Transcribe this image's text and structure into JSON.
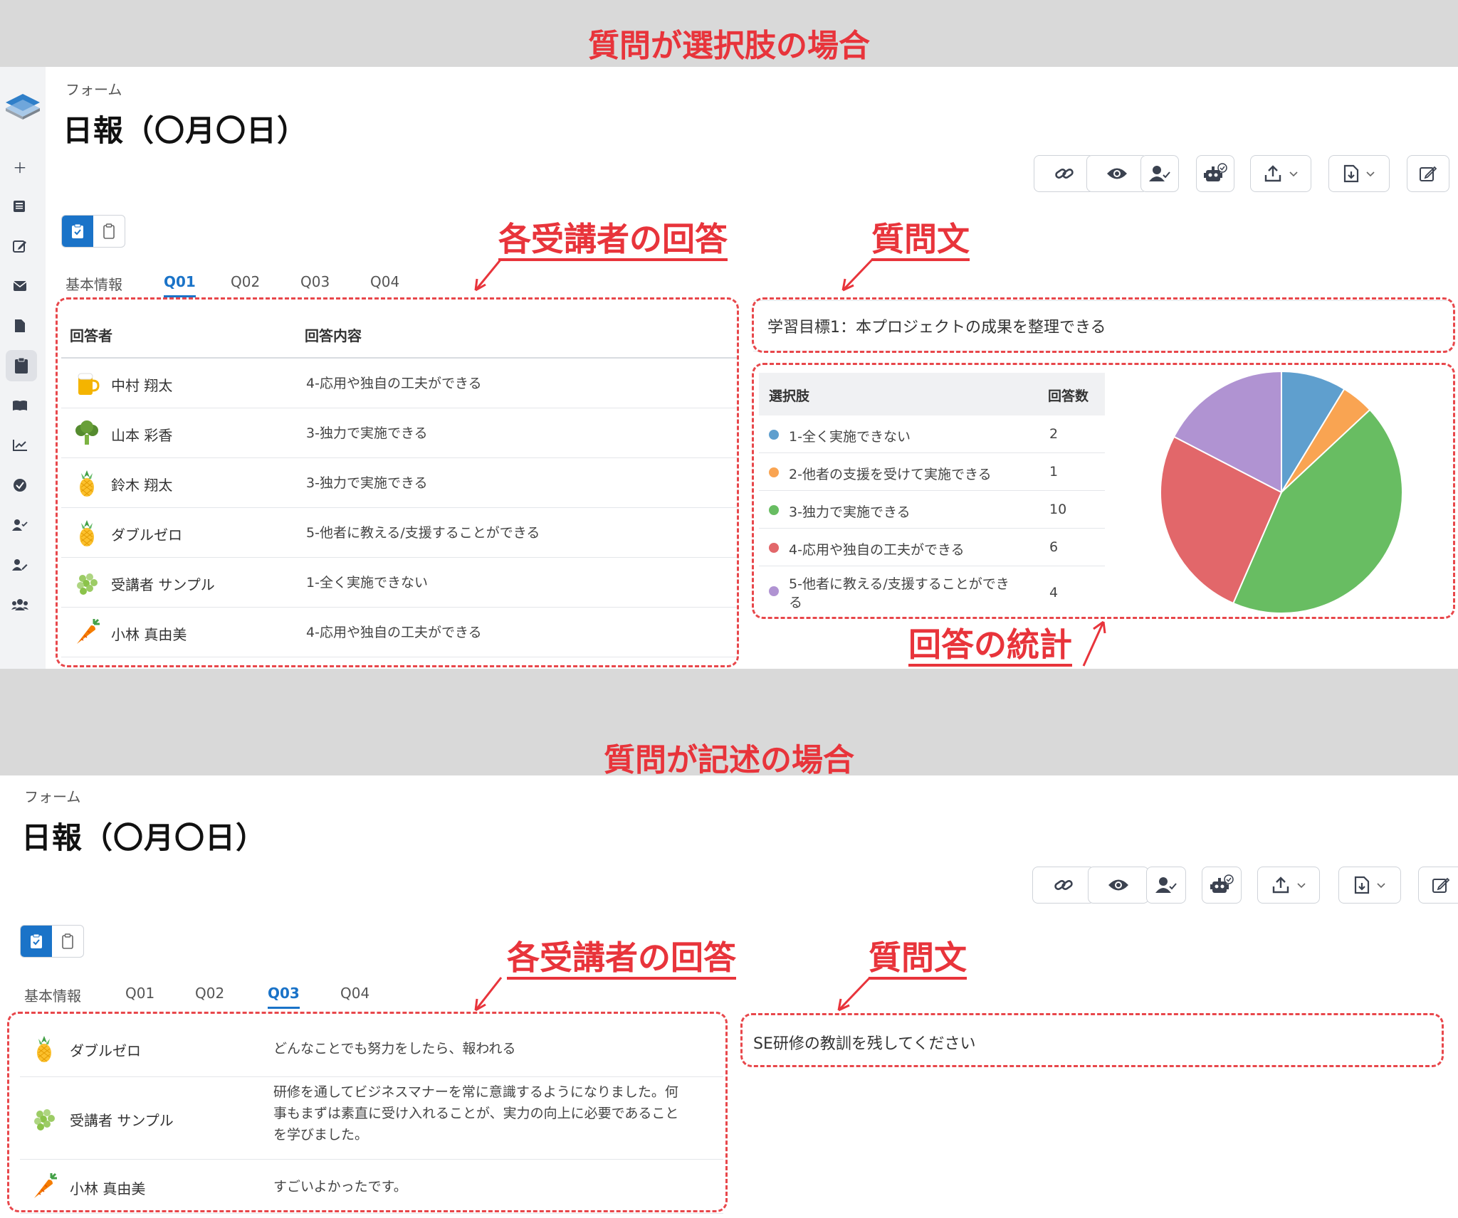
{
  "annotations": {
    "top_title": "質問が選択肢の場合",
    "bottom_title": "質問が記述の場合",
    "responses_label": "各受講者の回答",
    "question_label": "質問文",
    "stats_label": "回答の統計"
  },
  "header": {
    "breadcrumb": "フォーム",
    "title": "日報（〇月〇日）"
  },
  "tabs": [
    "基本情報",
    "Q01",
    "Q02",
    "Q03",
    "Q04"
  ],
  "choice_view": {
    "active_tab": "Q01",
    "columns": {
      "respondent": "回答者",
      "answer": "回答内容"
    },
    "rows": [
      {
        "name": "中村 翔太",
        "answer": "4-応用や独自の工夫ができる",
        "avatar": "beer-icon"
      },
      {
        "name": "山本 彩香",
        "answer": "3-独力で実施できる",
        "avatar": "broccoli-icon"
      },
      {
        "name": "鈴木 翔太",
        "answer": "3-独力で実施できる",
        "avatar": "pineapple-icon"
      },
      {
        "name": "ダブルゼロ",
        "answer": "5-他者に教える/支援することができる",
        "avatar": "pineapple-icon"
      },
      {
        "name": "受講者 サンプル",
        "answer": "1-全く実施できない",
        "avatar": "grapes-icon"
      },
      {
        "name": "小林 真由美",
        "answer": "4-応用や独自の工夫ができる",
        "avatar": "carrot-icon"
      }
    ],
    "question": "学習目標1：本プロジェクトの成果を整理できる",
    "stats_columns": {
      "choice": "選択肢",
      "count": "回答数"
    },
    "stats_rows": [
      {
        "label": "1-全く実施できない",
        "count": "2",
        "color": "#5f9fce"
      },
      {
        "label": "2-他者の支援を受けて実施できる",
        "count": "1",
        "color": "#f9a452"
      },
      {
        "label": "3-独力で実施できる",
        "count": "10",
        "color": "#68bd62"
      },
      {
        "label": "4-応用や独自の工夫ができる",
        "count": "6",
        "color": "#e2676a"
      },
      {
        "label": "5-他者に教える/支援することができる",
        "label_line1": "5-他者に教える/支援することができ",
        "label_line2": "る",
        "count": "4",
        "color": "#b093d2"
      }
    ]
  },
  "chart_data": {
    "type": "pie",
    "categories": [
      "1-全く実施できない",
      "2-他者の支援を受けて実施できる",
      "3-独力で実施できる",
      "4-応用や独自の工夫ができる",
      "5-他者に教える/支援することができる"
    ],
    "values": [
      2,
      1,
      10,
      6,
      4
    ],
    "colors": [
      "#5f9fce",
      "#f9a452",
      "#68bd62",
      "#e2676a",
      "#b093d2"
    ]
  },
  "text_view": {
    "active_tab": "Q03",
    "rows": [
      {
        "name": "ダブルゼロ",
        "answer_lines": [
          "どんなことでも努力をしたら、報われる"
        ],
        "avatar": "pineapple-icon"
      },
      {
        "name": "受講者 サンプル",
        "answer_lines": [
          "研修を通してビジネスマナーを常に意識するようになりました。何",
          "事もまずは素直に受け入れることが、実力の向上に必要であること",
          "を学びました。"
        ],
        "avatar": "grapes-icon"
      },
      {
        "name": "小林 真由美",
        "answer_lines": [
          "すごいよかったです。"
        ],
        "avatar": "carrot-icon"
      }
    ],
    "question": "SE研修の教訓を残してください"
  },
  "icons": {
    "sidebar": [
      "plus-icon",
      "news-icon",
      "edit-icon",
      "mail-icon",
      "file-icon",
      "clipboard-icon",
      "book-icon",
      "chart-line-icon",
      "check-circle-icon",
      "user-check-icon",
      "user-edit-icon",
      "users-icon"
    ],
    "toolbar": [
      "link-icon",
      "eye-icon",
      "user-check-icon",
      "robot-icon",
      "upload-icon",
      "download-file-icon",
      "edit-icon"
    ]
  }
}
